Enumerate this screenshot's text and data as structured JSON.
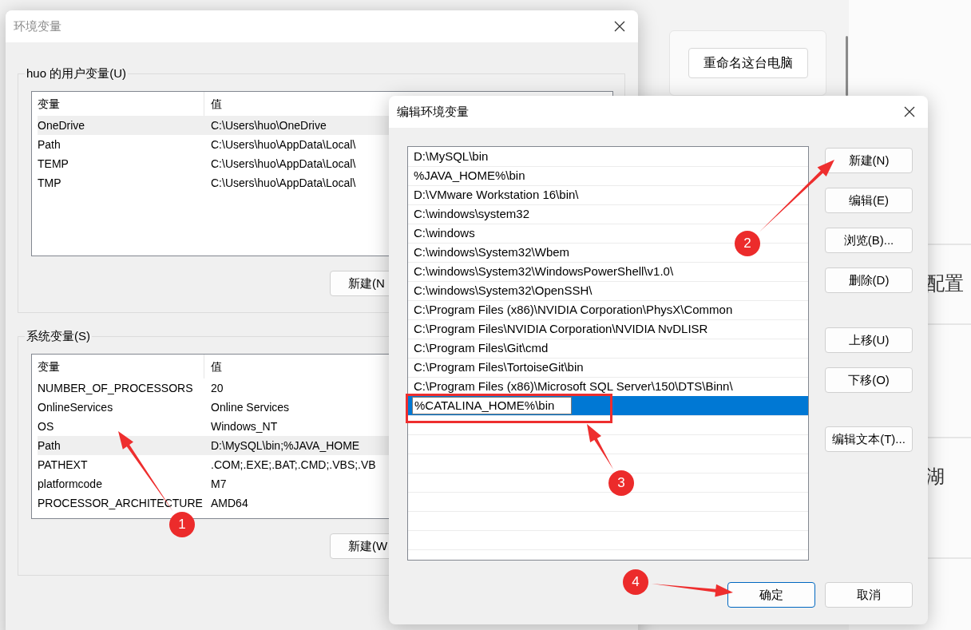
{
  "background": {
    "rename_button": "重命名这台电脑",
    "row_texts": [
      "配置",
      "湖"
    ]
  },
  "env_window": {
    "title": "环境变量",
    "user_group": {
      "title": "huo 的用户变量(U)",
      "columns": [
        "变量",
        "值"
      ],
      "rows": [
        {
          "name": "OneDrive",
          "value": "C:\\Users\\huo\\OneDrive",
          "selected": true
        },
        {
          "name": "Path",
          "value": "C:\\Users\\huo\\AppData\\Local\\",
          "selected": false
        },
        {
          "name": "TEMP",
          "value": "C:\\Users\\huo\\AppData\\Local\\",
          "selected": false
        },
        {
          "name": "TMP",
          "value": "C:\\Users\\huo\\AppData\\Local\\",
          "selected": false
        }
      ],
      "new_button": "新建(N"
    },
    "system_group": {
      "title": "系统变量(S)",
      "columns": [
        "变量",
        "值"
      ],
      "rows": [
        {
          "name": "NUMBER_OF_PROCESSORS",
          "value": "20",
          "selected": false
        },
        {
          "name": "OnlineServices",
          "value": "Online Services",
          "selected": false
        },
        {
          "name": "OS",
          "value": "Windows_NT",
          "selected": false
        },
        {
          "name": "Path",
          "value": "D:\\MySQL\\bin;%JAVA_HOME",
          "selected": true
        },
        {
          "name": "PATHEXT",
          "value": ".COM;.EXE;.BAT;.CMD;.VBS;.VB",
          "selected": false
        },
        {
          "name": "platformcode",
          "value": "M7",
          "selected": false
        },
        {
          "name": "PROCESSOR_ARCHITECTURE",
          "value": "AMD64",
          "selected": false
        }
      ],
      "new_button": "新建(W"
    }
  },
  "edit_window": {
    "title": "编辑环境变量",
    "entries": [
      {
        "text": "D:\\MySQL\\bin",
        "selected": false
      },
      {
        "text": "%JAVA_HOME%\\bin",
        "selected": false
      },
      {
        "text": "D:\\VMware Workstation 16\\bin\\",
        "selected": false
      },
      {
        "text": "C:\\windows\\system32",
        "selected": false
      },
      {
        "text": "C:\\windows",
        "selected": false
      },
      {
        "text": "C:\\windows\\System32\\Wbem",
        "selected": false
      },
      {
        "text": "C:\\windows\\System32\\WindowsPowerShell\\v1.0\\",
        "selected": false
      },
      {
        "text": "C:\\windows\\System32\\OpenSSH\\",
        "selected": false
      },
      {
        "text": "C:\\Program Files (x86)\\NVIDIA Corporation\\PhysX\\Common",
        "selected": false
      },
      {
        "text": "C:\\Program Files\\NVIDIA Corporation\\NVIDIA NvDLISR",
        "selected": false
      },
      {
        "text": "C:\\Program Files\\Git\\cmd",
        "selected": false
      },
      {
        "text": "C:\\Program Files\\TortoiseGit\\bin",
        "selected": false
      },
      {
        "text": "C:\\Program Files (x86)\\Microsoft SQL Server\\150\\DTS\\Binn\\",
        "selected": false
      },
      {
        "text": "%CATALINA_HOME%\\bin",
        "selected": true
      }
    ],
    "button_groups": [
      [
        "新建(N)",
        "编辑(E)",
        "浏览(B)...",
        "删除(D)"
      ],
      [
        "上移(U)",
        "下移(O)"
      ],
      [
        "编辑文本(T)..."
      ]
    ],
    "ok_button": "确定",
    "cancel_button": "取消"
  },
  "annotations": {
    "markers": [
      {
        "label": "1"
      },
      {
        "label": "2"
      },
      {
        "label": "3"
      },
      {
        "label": "4"
      }
    ]
  }
}
